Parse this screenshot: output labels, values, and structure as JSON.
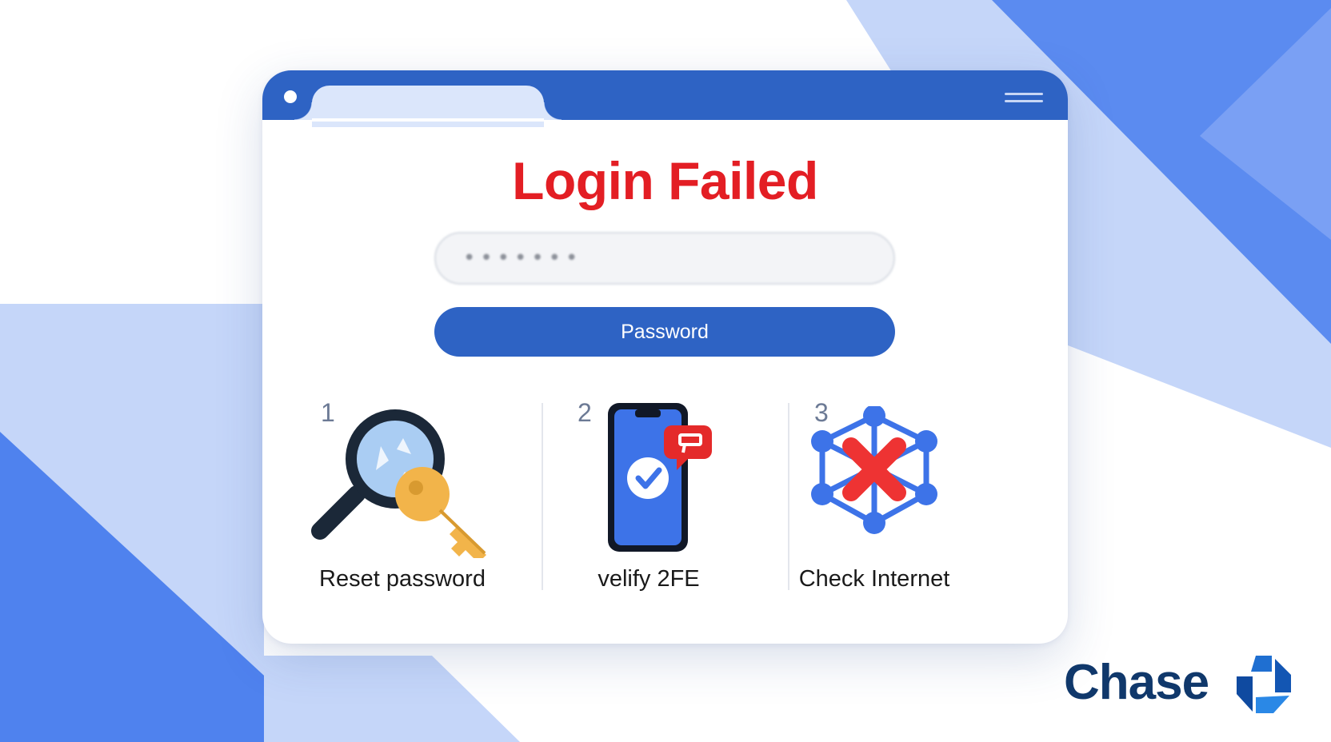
{
  "window": {
    "heading": "Login Failed",
    "password_value": "•••••••",
    "password_button_label": "Password"
  },
  "steps": [
    {
      "number": "1",
      "label": "Reset password",
      "icon": "magnifier-key-icon"
    },
    {
      "number": "2",
      "label": "velify 2FE",
      "icon": "phone-verify-icon"
    },
    {
      "number": "3",
      "label": "Check  Internet",
      "icon": "network-error-icon"
    }
  ],
  "brand": {
    "name": "Chase",
    "logo_icon": "octagon-logo-icon"
  },
  "colors": {
    "accent": "#2e63c4",
    "error": "#e31e24",
    "brand": "#10386b",
    "background_light": "#c5d6f9",
    "background_mid": "#5b8bf0"
  }
}
